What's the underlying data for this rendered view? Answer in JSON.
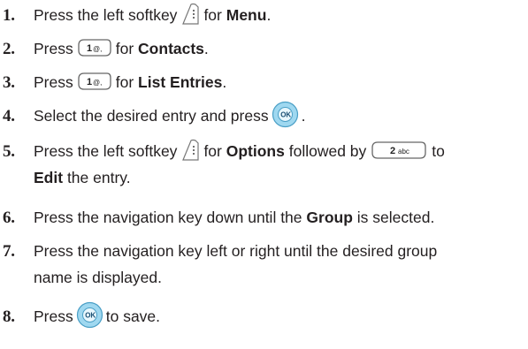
{
  "steps": [
    {
      "num": "1.",
      "parts": {
        "a": "Press the left softkey",
        "b": "for",
        "c": "Menu",
        "d": "."
      }
    },
    {
      "num": "2.",
      "parts": {
        "a": "Press",
        "key": "1",
        "keysub": "@,",
        "b": "for",
        "c": "Contacts",
        "d": "."
      }
    },
    {
      "num": "3.",
      "parts": {
        "a": "Press",
        "key": "1",
        "keysub": "@,",
        "b": "for",
        "c": "List Entries",
        "d": "."
      }
    },
    {
      "num": "4.",
      "parts": {
        "a": "Select the desired entry and press",
        "d": "."
      }
    },
    {
      "num": "5.",
      "parts": {
        "a": "Press the left softkey",
        "b": "for",
        "c": "Options",
        "e": "followed by",
        "key": "2",
        "keysub": "abc",
        "f": "to",
        "g": "Edit",
        "h": "the entry."
      }
    },
    {
      "num": "6.",
      "parts": {
        "a": "Press the navigation key down until the",
        "c": "Group",
        "d": "is selected."
      }
    },
    {
      "num": "7.",
      "parts": {
        "line1": "Press the navigation key left or right until the desired group",
        "line2": "name is displayed."
      }
    },
    {
      "num": "8.",
      "parts": {
        "a": "Press",
        "d": "to save."
      }
    }
  ],
  "icons": {
    "softkey": "left-softkey-icon",
    "key1": "key-1-icon",
    "key2": "key-2-icon",
    "ok": "ok-button-icon"
  }
}
